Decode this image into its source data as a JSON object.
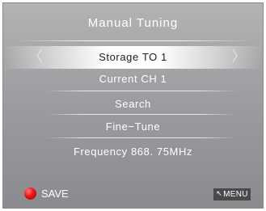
{
  "title": "Manual Tuning",
  "items": {
    "storage": "Storage  TO  1",
    "current_ch": "Current  CH  1",
    "search": "Search",
    "fine_tune": "Fine−Tune",
    "frequency": "Frequency  868. 75MHz"
  },
  "nav": {
    "left_arrow": "〈",
    "right_arrow": "〉"
  },
  "footer": {
    "save_label": "SAVE",
    "menu_label": "MENU",
    "menu_arrow": "↖",
    "save_color": "#e81414"
  }
}
